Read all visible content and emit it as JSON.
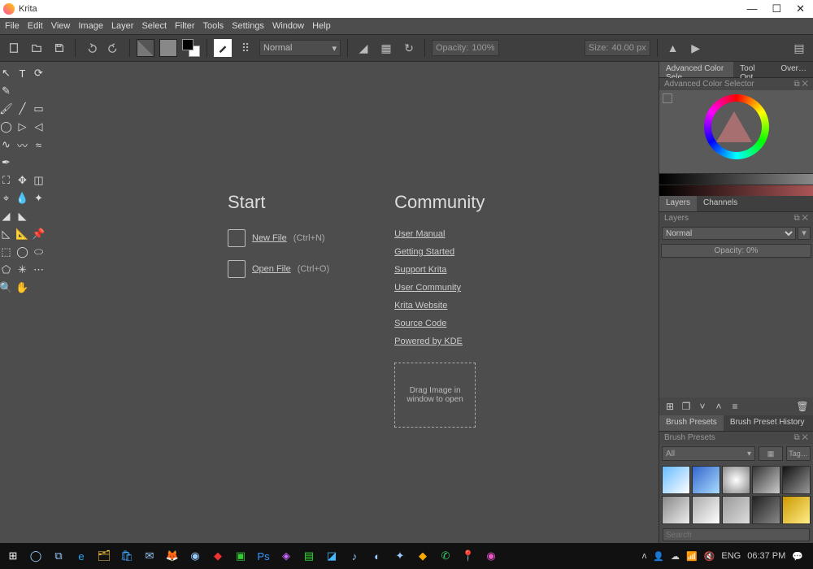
{
  "titlebar": {
    "app_name": "Krita"
  },
  "window_controls": {
    "min": "—",
    "max": "☐",
    "close": "✕"
  },
  "menu": [
    "File",
    "Edit",
    "View",
    "Image",
    "Layer",
    "Select",
    "Filter",
    "Tools",
    "Settings",
    "Window",
    "Help"
  ],
  "toolbar": {
    "blend_mode": "Normal",
    "opacity_label": "Opacity:",
    "opacity_value": "100%",
    "size_label": "Size:",
    "size_value": "40.00 px"
  },
  "welcome": {
    "start_title": "Start",
    "new_file": "New File",
    "new_shortcut": "(Ctrl+N)",
    "open_file": "Open File",
    "open_shortcut": "(Ctrl+O)",
    "community_title": "Community",
    "links": [
      "User Manual",
      "Getting Started",
      "Support Krita",
      "User Community",
      "Krita Website",
      "Source Code",
      "Powered by KDE"
    ],
    "dropzone": "Drag Image in window to open"
  },
  "right_tabs_top": [
    "Advanced Color Sele…",
    "Tool Opt…",
    "Over…"
  ],
  "color_panel_title": "Advanced Color Selector",
  "layer_tabs": [
    "Layers",
    "Channels"
  ],
  "layers_panel": {
    "title": "Layers",
    "blend": "Normal",
    "opacity": "Opacity: 0%"
  },
  "brush_tabs": [
    "Brush Presets",
    "Brush Preset History"
  ],
  "brush_panel": {
    "title": "Brush Presets",
    "filter": "All",
    "tag": "Tag…",
    "search_placeholder": "Search"
  },
  "tray": {
    "lang": "ENG",
    "time": "06:37 PM"
  }
}
